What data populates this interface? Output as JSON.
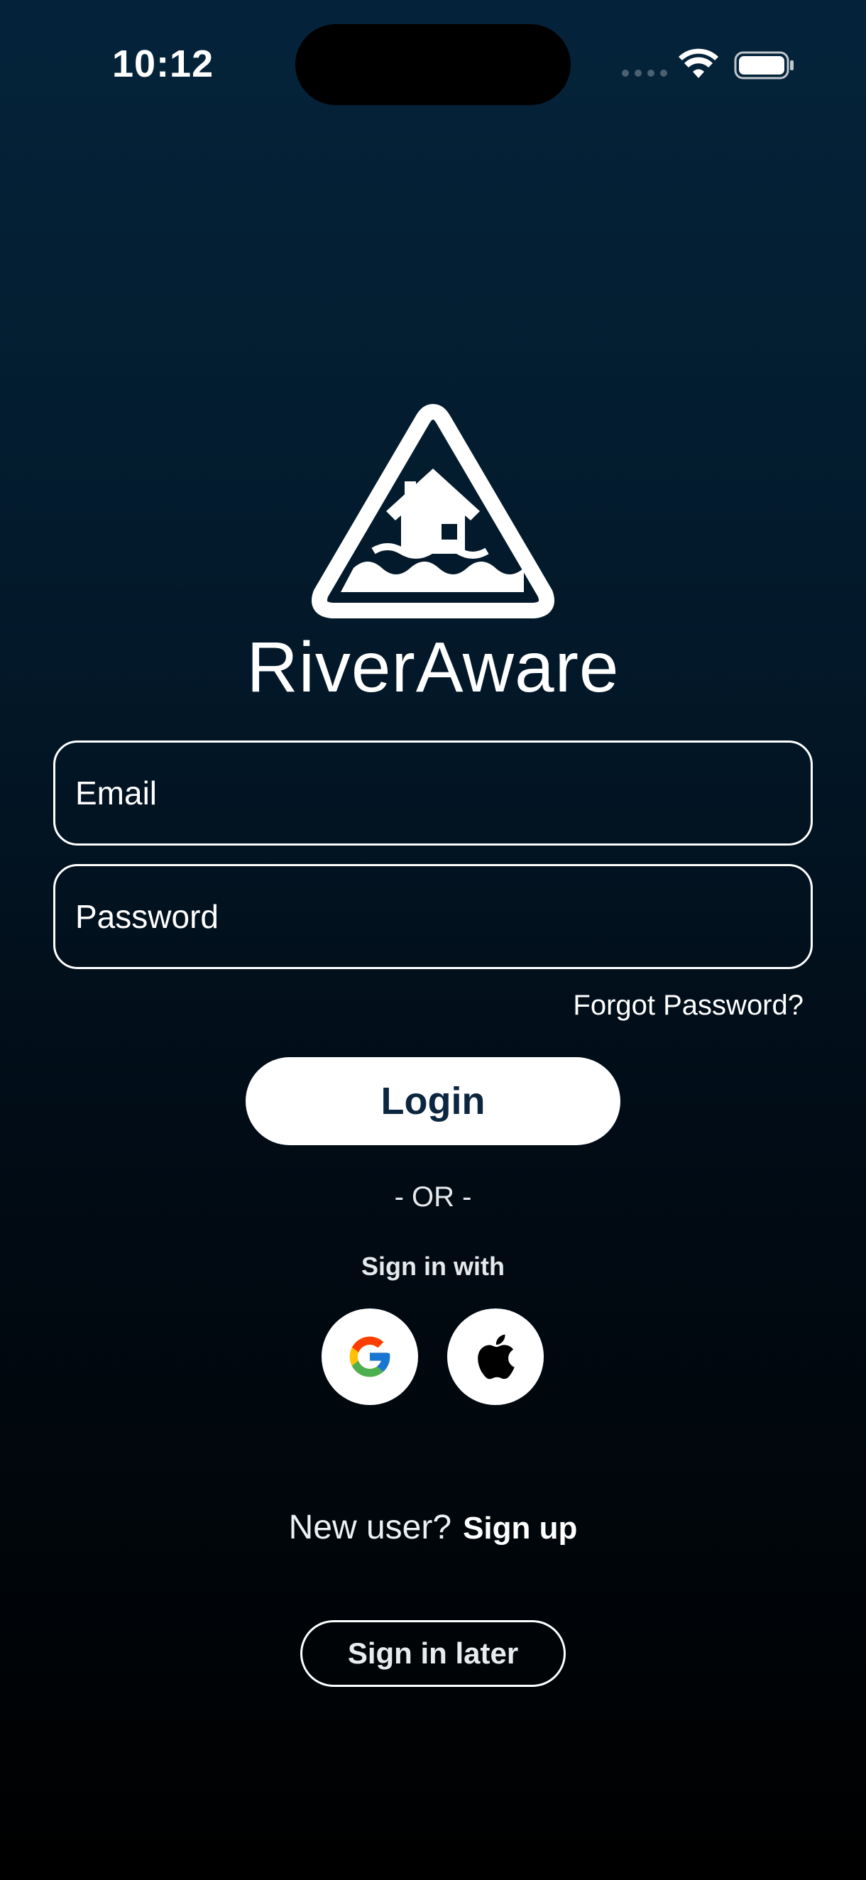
{
  "status_bar": {
    "time": "10:12"
  },
  "app": {
    "name": "RiverAware"
  },
  "form": {
    "email_placeholder": "Email",
    "password_placeholder": "Password",
    "forgot_password": "Forgot Password?",
    "login_label": "Login"
  },
  "alt_auth": {
    "or_label": "- OR -",
    "sign_in_with": "Sign in with",
    "providers": [
      "google-icon",
      "apple-icon"
    ]
  },
  "footer": {
    "new_user": "New user?",
    "sign_up": "Sign up",
    "sign_in_later": "Sign in later"
  },
  "colors": {
    "background_top": "#04233a",
    "background_bottom": "#000000",
    "login_text": "#0c2640",
    "google_blue": "#4285F4",
    "google_red": "#EA4335",
    "google_yellow": "#FBBC05",
    "google_green": "#34A853"
  }
}
